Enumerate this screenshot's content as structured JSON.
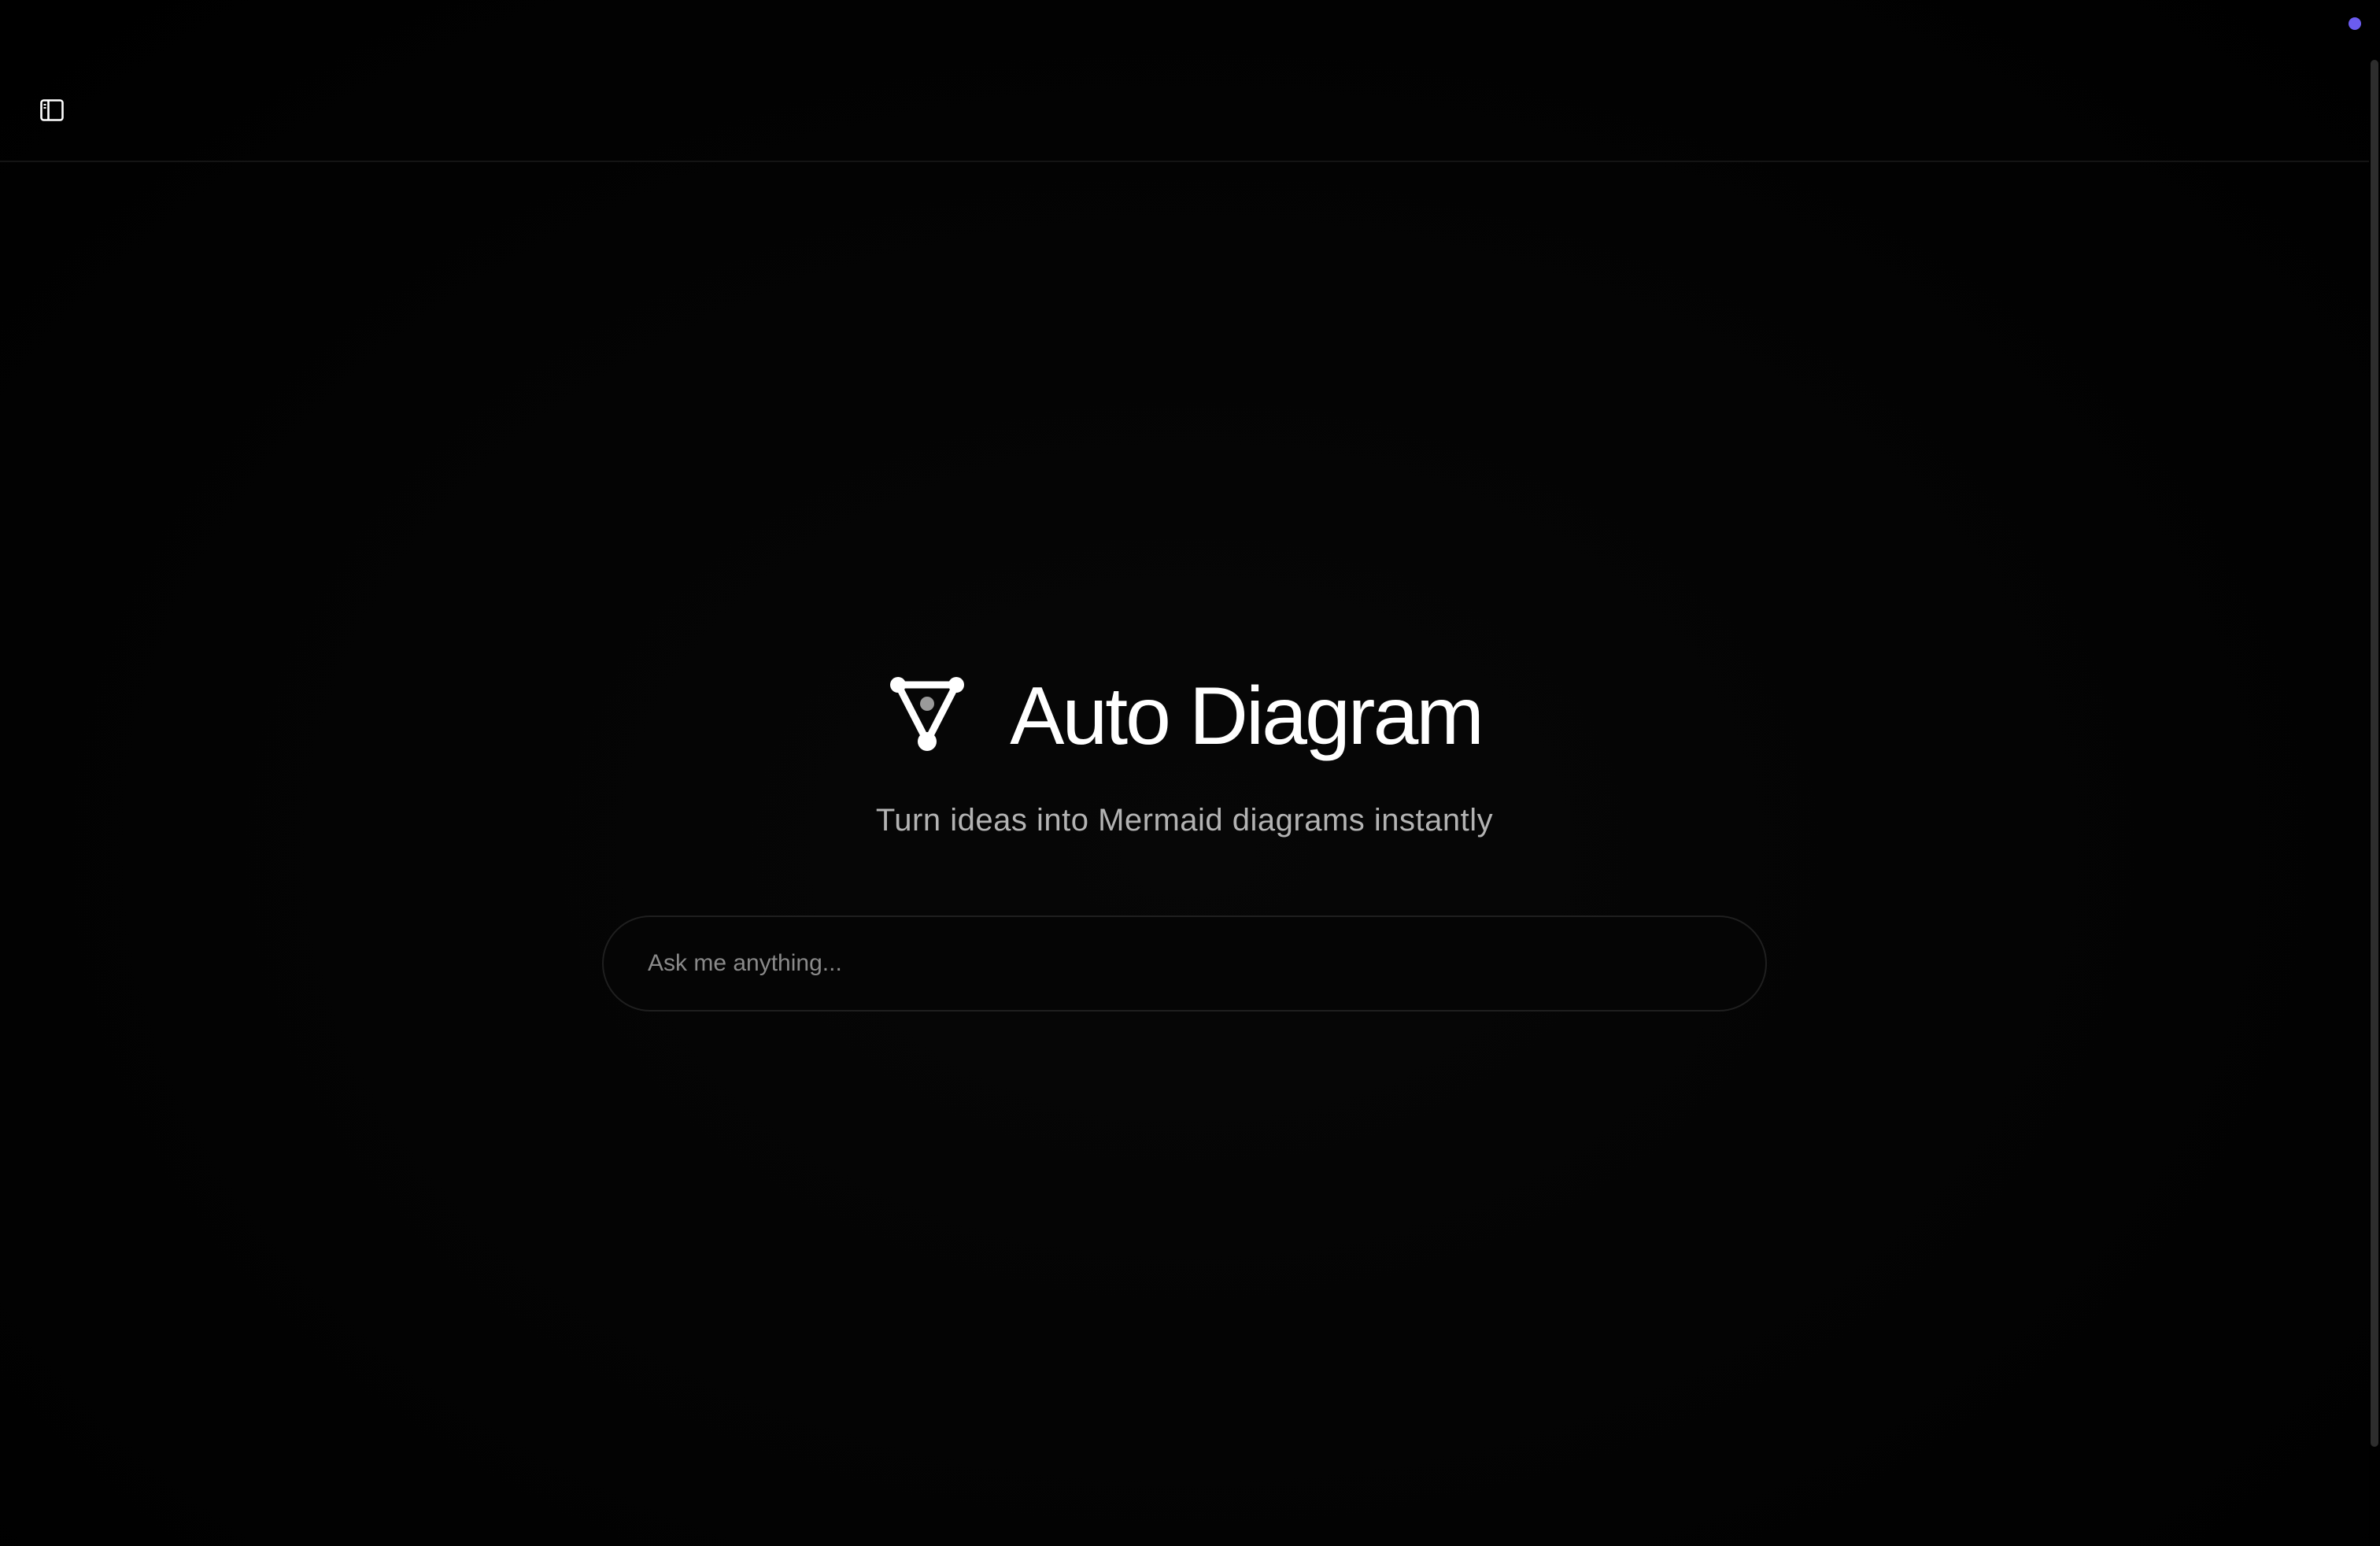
{
  "app": {
    "title": "Auto Diagram",
    "tagline": "Turn ideas into Mermaid diagrams instantly"
  },
  "header": {
    "sidebar_toggle_icon": "sidebar-panel-icon"
  },
  "search": {
    "placeholder": "Ask me anything...",
    "value": ""
  },
  "icons": {
    "logo": "triangle-nodes-logo-icon",
    "status": "status-dot-indicator"
  },
  "colors": {
    "background": "#000000",
    "title": "#ffffff",
    "tagline": "#b3b3b3",
    "placeholder": "#8a8a8a",
    "status_dot": "#6b5cf0"
  }
}
